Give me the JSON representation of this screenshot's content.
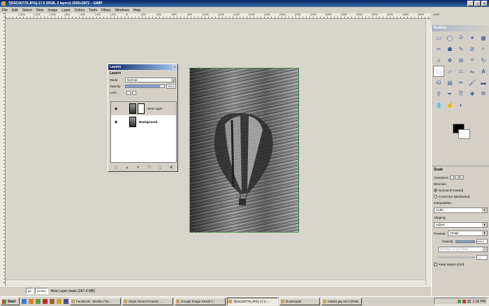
{
  "window": {
    "title": "*[DSC00779.JPG]-17.0 (RGB, 2 layers) 2592x3872 – GIMP",
    "controls": [
      "_",
      "□",
      "×"
    ]
  },
  "menu": [
    "File",
    "Edit",
    "Select",
    "View",
    "Image",
    "Layer",
    "Colors",
    "Tools",
    "Filters",
    "Windows",
    "Help"
  ],
  "ruler": {
    "h_ticks": [
      "|-1400",
      "|-1200",
      "|-1000",
      "|-800",
      "|-600",
      "|-400",
      "|-200",
      "|0",
      "|200",
      "|400",
      "|600",
      "|800",
      "|1000",
      "|1200",
      "|1400",
      "|1600",
      "|1800",
      "|2000",
      "|2200",
      "|2400",
      "|2600",
      "|2800",
      "|3000",
      "|3200",
      "|3400",
      "|3600",
      "|3800",
      "|4000"
    ]
  },
  "layers_dialog": {
    "title": "Layers",
    "tab": "Layers",
    "mode_label": "Mode:",
    "mode_value": "Normal",
    "opacity_label": "Opacity:",
    "opacity_value": "100.0",
    "lock_label": "Lock:",
    "layers": [
      {
        "name": "New Layer",
        "active": true
      },
      {
        "name": "Background",
        "active": false
      }
    ]
  },
  "status": {
    "unit": "px",
    "zoom": "12.5%",
    "message": "New Layer mask (267.4 MB)"
  },
  "toolbox": {
    "title": "Toolbox",
    "tool_options": {
      "title": "Scale",
      "transform_label": "Transform:",
      "direction_label": "Direction",
      "direction_options": [
        "Normal (Forward)",
        "Corrective (Backward)"
      ],
      "interpolation_label": "Interpolation:",
      "interpolation_value": "Cubic",
      "clipping_label": "Clipping:",
      "clipping_value": "Adjust",
      "preview_label": "Preview:",
      "preview_value": "Image",
      "opacity_label": "Opacity:",
      "opacity_value": "100.0",
      "guides_value": "Number of grid lines",
      "grid_value": "15",
      "keep_aspect_label": "Keep aspect (Ctrl)"
    }
  },
  "taskbar": {
    "start_label": "Start",
    "tasks": [
      "Facebook - Mozilla Fire...",
      "Sepia Toned Pictures: ...",
      "Google Image Result f...",
      "*[DSC00779.JPG]-17.0 ...",
      "Downloads",
      "metal1.jpg-19.0 (RGB, ..."
    ],
    "active_task_index": 3,
    "clock": "1:16 PM"
  }
}
